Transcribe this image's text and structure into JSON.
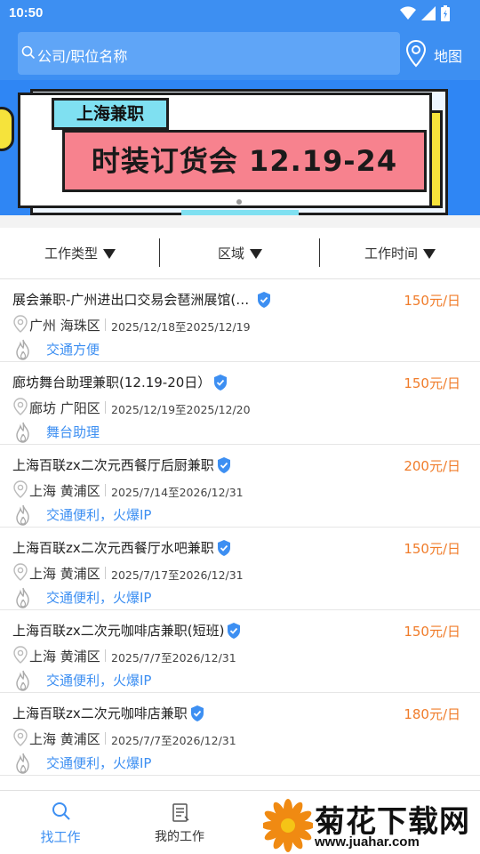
{
  "status_bar": {
    "time": "10:50",
    "icons": [
      "wifi-icon",
      "signal-icon",
      "battery-icon"
    ]
  },
  "header": {
    "search_placeholder": "公司/职位名称",
    "map_label": "地图"
  },
  "banner": {
    "tag": "上海兼职",
    "headline": "时装订货会  12.19-24"
  },
  "filters": [
    {
      "label": "工作类型"
    },
    {
      "label": "区域"
    },
    {
      "label": "工作时间"
    }
  ],
  "jobs": [
    {
      "title": "展会兼职-广州进出口交易会琶洲展馆(1...",
      "salary": "150元/日",
      "location": "广州 海珠区",
      "dates": "2025/12/18至2025/12/19",
      "tags": "交通方便",
      "verified": true
    },
    {
      "title": "廊坊舞台助理兼职(12.19-20日）",
      "salary": "150元/日",
      "location": "廊坊 广阳区",
      "dates": "2025/12/19至2025/12/20",
      "tags": "舞台助理",
      "verified": true
    },
    {
      "title": "上海百联zx二次元西餐厅后厨兼职",
      "salary": "200元/日",
      "location": "上海 黄浦区",
      "dates": "2025/7/14至2026/12/31",
      "tags": "交通便利，火爆IP",
      "verified": true
    },
    {
      "title": "上海百联zx二次元西餐厅水吧兼职",
      "salary": "150元/日",
      "location": "上海 黄浦区",
      "dates": "2025/7/17至2026/12/31",
      "tags": "交通便利，火爆IP",
      "verified": true
    },
    {
      "title": "上海百联zx二次元咖啡店兼职(短班)",
      "salary": "150元/日",
      "location": "上海 黄浦区",
      "dates": "2025/7/7至2026/12/31",
      "tags": "交通便利，火爆IP",
      "verified": true
    },
    {
      "title": "上海百联zx二次元咖啡店兼职",
      "salary": "180元/日",
      "location": "上海 黄浦区",
      "dates": "2025/7/7至2026/12/31",
      "tags": "交通便利，火爆IP",
      "verified": true
    }
  ],
  "tabbar": {
    "tabs": [
      {
        "label": "找工作",
        "active": true,
        "icon": "search-icon"
      },
      {
        "label": "我的工作",
        "active": false,
        "icon": "clipboard-icon"
      }
    ]
  },
  "watermark": {
    "title": "菊花下载网",
    "url": "www.juahar.com"
  },
  "colors": {
    "primary": "#3d8ff2",
    "salary": "#f07c2a",
    "tag": "#3d8ff2"
  }
}
